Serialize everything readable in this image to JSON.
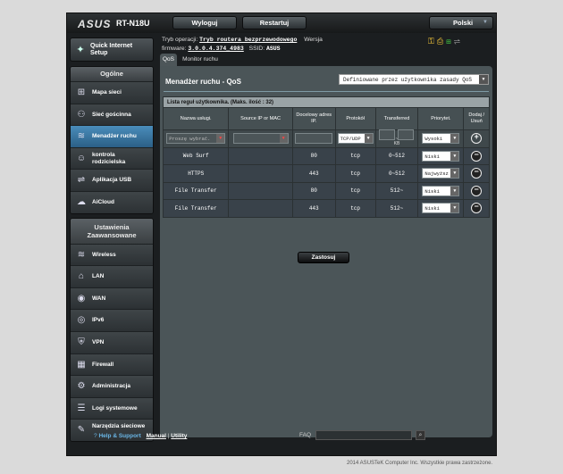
{
  "header": {
    "brand": "ASUS",
    "model": "RT-N18U",
    "logout": "Wyloguj",
    "restart": "Restartuj",
    "language": "Polski"
  },
  "sidebar": {
    "qis": "Quick Internet Setup",
    "general_title": "Ogólne",
    "general": [
      {
        "label": "Mapa sieci",
        "icon": "network-map-icon"
      },
      {
        "label": "Sieć gościnna",
        "icon": "guest-network-icon"
      },
      {
        "label": "Menadżer ruchu",
        "icon": "traffic-manager-icon"
      },
      {
        "label": "kontrola rodzicielska",
        "icon": "parental-control-icon"
      },
      {
        "label": "Aplikacja USB",
        "icon": "usb-app-icon"
      },
      {
        "label": "AiCloud",
        "icon": "cloud-icon"
      }
    ],
    "advanced_title": "Ustawienia Zaawansowane",
    "advanced": [
      {
        "label": "Wireless",
        "icon": "wifi-icon"
      },
      {
        "label": "LAN",
        "icon": "lan-icon"
      },
      {
        "label": "WAN",
        "icon": "wan-icon"
      },
      {
        "label": "IPv6",
        "icon": "ipv6-icon"
      },
      {
        "label": "VPN",
        "icon": "vpn-icon"
      },
      {
        "label": "Firewall",
        "icon": "firewall-icon"
      },
      {
        "label": "Administracja",
        "icon": "admin-icon"
      },
      {
        "label": "Logi systemowe",
        "icon": "log-icon"
      },
      {
        "label": "Narzędzia sieciowe",
        "icon": "tools-icon"
      }
    ]
  },
  "info": {
    "mode_label": "Tryb operacji:",
    "mode_value": "Tryb routera bezprzewodowego",
    "version_label": "Wersja",
    "firmware_label": "firmware:",
    "firmware_value": "3.0.0.4.374_4983",
    "ssid_label": "SSID:",
    "ssid_value": "ASUS"
  },
  "tabs": [
    "QoS",
    "Monitor ruchu"
  ],
  "panel": {
    "title": "Menadżer ruchu - QoS",
    "mode_select": "Definiowane przez użytkownika zasady QoS",
    "table_caption": "Lista reguł użytkownika. (Maks. ilość : 32)",
    "columns": [
      "Nazwa usługi.",
      "Source IP or MAC",
      "Docelowy adres IP.",
      "Protokół",
      "Transferred",
      "Priorytet.",
      "Dodaj / Usuń"
    ],
    "input_row": {
      "service_placeholder": "Proszę wybrać.",
      "protocol": "TCP/UDP",
      "unit": "KB",
      "priority": "Wysoki"
    },
    "rows": [
      {
        "name": "Web Surf",
        "src": "",
        "port": "80",
        "proto": "tcp",
        "transferred": "0~512",
        "priority": "Niski"
      },
      {
        "name": "HTTPS",
        "src": "",
        "port": "443",
        "proto": "tcp",
        "transferred": "0~512",
        "priority": "Najwyższ"
      },
      {
        "name": "File Transfer",
        "src": "",
        "port": "80",
        "proto": "tcp",
        "transferred": "512~",
        "priority": "Niski"
      },
      {
        "name": "File Transfer",
        "src": "",
        "port": "443",
        "proto": "tcp",
        "transferred": "512~",
        "priority": "Niski"
      }
    ],
    "apply": "Zastosuj"
  },
  "footer": {
    "help": "Help & Support",
    "manual": "Manual",
    "sep": "|",
    "utility": "Utility",
    "faq": "FAQ",
    "copyright": "2014 ASUSTeK Computer Inc. Wszystkie prawa zastrzeżone."
  }
}
